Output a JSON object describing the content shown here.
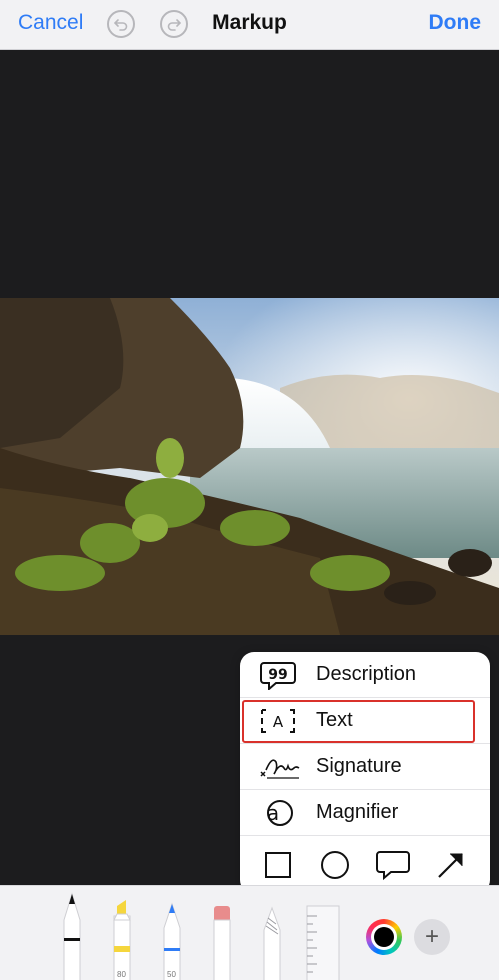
{
  "header": {
    "cancel_label": "Cancel",
    "title": "Markup",
    "done_label": "Done",
    "undo_icon": "undo-icon",
    "redo_icon": "redo-icon"
  },
  "canvas": {
    "image_icon": "waterfall-landscape-photo"
  },
  "popup_menu": {
    "items": [
      {
        "label": "Description",
        "icon": "quote-bubble-icon"
      },
      {
        "label": "Text",
        "icon": "text-box-icon",
        "highlighted": true
      },
      {
        "label": "Signature",
        "icon": "signature-icon"
      },
      {
        "label": "Magnifier",
        "icon": "magnifier-icon"
      }
    ],
    "shapes": [
      {
        "icon": "square-icon"
      },
      {
        "icon": "circle-icon"
      },
      {
        "icon": "speech-bubble-icon"
      },
      {
        "icon": "arrow-icon"
      }
    ]
  },
  "toolbar": {
    "tools": [
      {
        "icon": "pen-icon",
        "tip_color": "#111111"
      },
      {
        "icon": "highlighter-icon",
        "tip_color": "#f5d63d",
        "value": "80"
      },
      {
        "icon": "pencil-icon",
        "tip_color": "#2f7cf6",
        "value": "50"
      },
      {
        "icon": "eraser-icon",
        "tip_color": "#e88c8c"
      },
      {
        "icon": "lasso-icon"
      },
      {
        "icon": "ruler-icon"
      }
    ],
    "color_icon": "color-picker-icon",
    "selected_color": "#000000",
    "add_label": "+"
  },
  "colors": {
    "accent": "#2f7cf6",
    "highlight_border": "#d9312b"
  }
}
